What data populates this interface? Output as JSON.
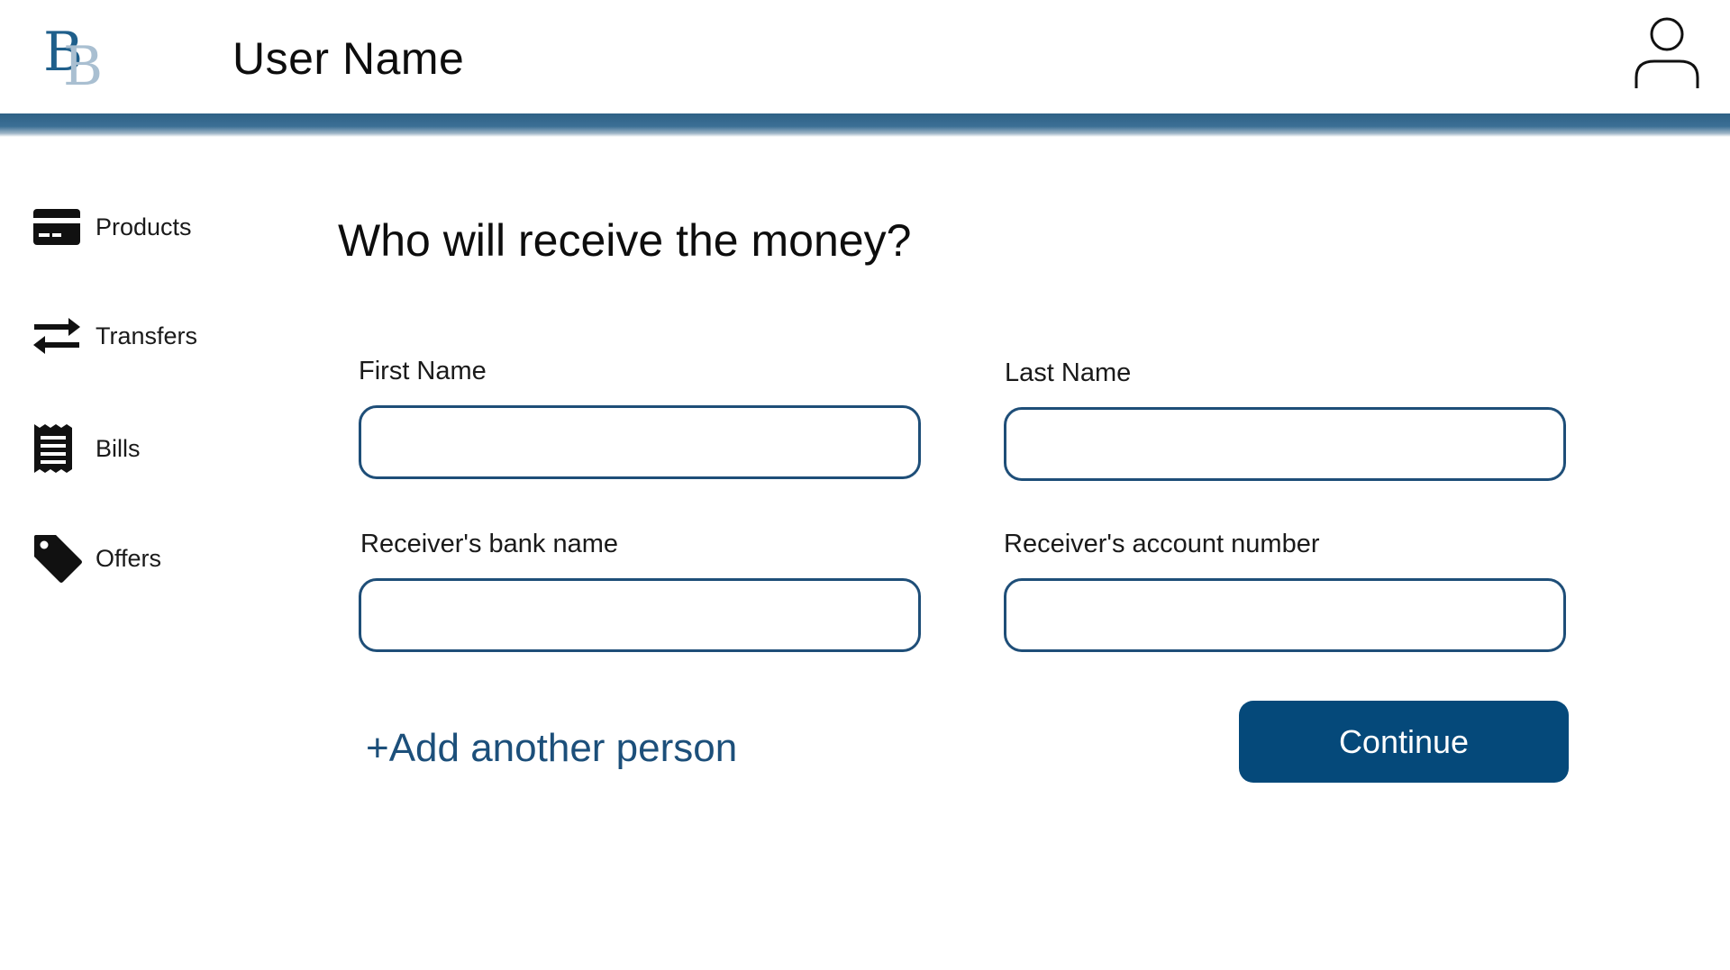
{
  "header": {
    "logo_letters": "BB",
    "user_name": "User Name",
    "accent_color": "#2f6185"
  },
  "sidebar": {
    "items": [
      {
        "label": "Products",
        "icon": "credit-card-icon"
      },
      {
        "label": "Transfers",
        "icon": "transfer-arrows-icon"
      },
      {
        "label": "Bills",
        "icon": "receipt-icon"
      },
      {
        "label": "Offers",
        "icon": "tag-icon"
      }
    ]
  },
  "form": {
    "title": "Who will receive the money?",
    "first_name": {
      "label": "First Name",
      "value": ""
    },
    "last_name": {
      "label": "Last Name",
      "value": ""
    },
    "bank_name": {
      "label": "Receiver's bank name",
      "value": ""
    },
    "account_number": {
      "label": "Receiver's account number",
      "value": ""
    },
    "add_person_label": "+Add another person",
    "continue_label": "Continue",
    "input_border_color": "#1e4e78",
    "button_color": "#05497a"
  }
}
